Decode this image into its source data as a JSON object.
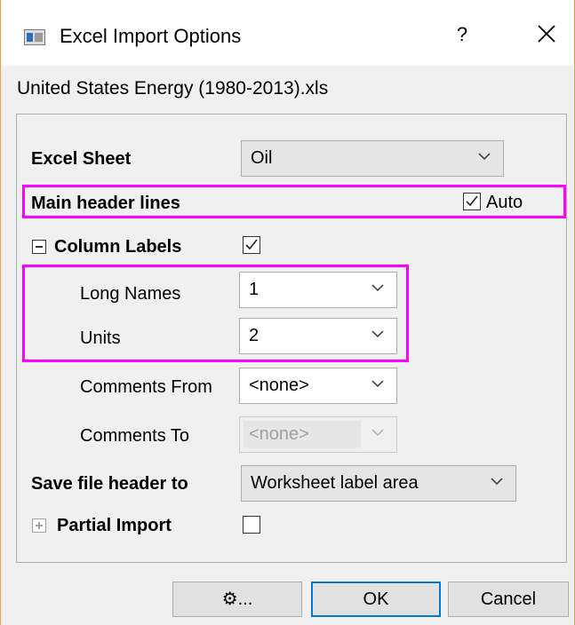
{
  "window": {
    "title": "Excel Import Options",
    "help_label": "?",
    "close_label": "✕",
    "filename": "United States Energy (1980-2013).xls"
  },
  "excel_sheet": {
    "label": "Excel Sheet",
    "value": "Oil"
  },
  "main_header": {
    "label": "Main header lines",
    "auto_label": "Auto",
    "auto_checked": true
  },
  "column_labels": {
    "label": "Column Labels",
    "checked": true,
    "long_names": {
      "label": "Long Names",
      "value": "1"
    },
    "units": {
      "label": "Units",
      "value": "2"
    },
    "comments_from": {
      "label": "Comments From",
      "value": "<none>"
    },
    "comments_to": {
      "label": "Comments To",
      "value": "<none>"
    }
  },
  "save_header": {
    "label": "Save file header to",
    "value": "Worksheet label area"
  },
  "partial_import": {
    "label": "Partial Import",
    "checked": false
  },
  "buttons": {
    "settings_label": "⚙...",
    "ok_label": "OK",
    "cancel_label": "Cancel"
  },
  "colors": {
    "highlight": "#ff00ff",
    "accent": "#0078d7",
    "window_border": "#e8a33d"
  }
}
